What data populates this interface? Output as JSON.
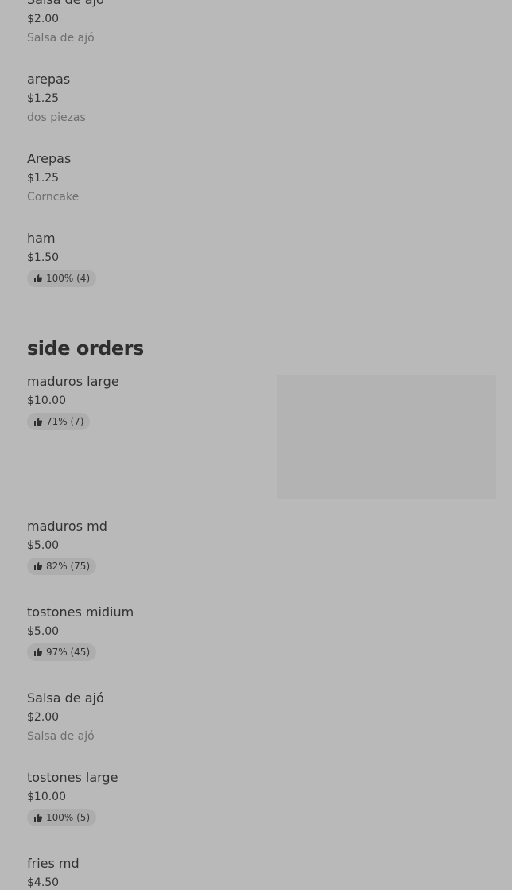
{
  "top_items": [
    {
      "name": "Salsa de ajó",
      "price": "$2.00",
      "desc": "Salsa de ajó"
    },
    {
      "name": "arepas",
      "price": "$1.25",
      "desc": "dos piezas"
    },
    {
      "name": "Arepas",
      "price": "$1.25",
      "desc": "Corncake"
    },
    {
      "name": "ham",
      "price": "$1.50",
      "rating": "100% (4)"
    }
  ],
  "section": {
    "title": "side orders"
  },
  "side_orders": [
    {
      "name": "maduros large",
      "price": "$10.00",
      "rating": "71% (7)"
    },
    {
      "name": "maduros md",
      "price": "$5.00",
      "rating": "82% (75)"
    },
    {
      "name": "tostones midium",
      "price": "$5.00",
      "rating": "97% (45)"
    },
    {
      "name": "Salsa de ajó",
      "price": "$2.00",
      "desc": "Salsa de ajó"
    },
    {
      "name": "tostones large",
      "price": "$10.00",
      "rating": "100% (5)"
    },
    {
      "name": "fries md",
      "price": "$4.50"
    }
  ],
  "icons": {
    "rating": "thumbs-up-icon"
  }
}
